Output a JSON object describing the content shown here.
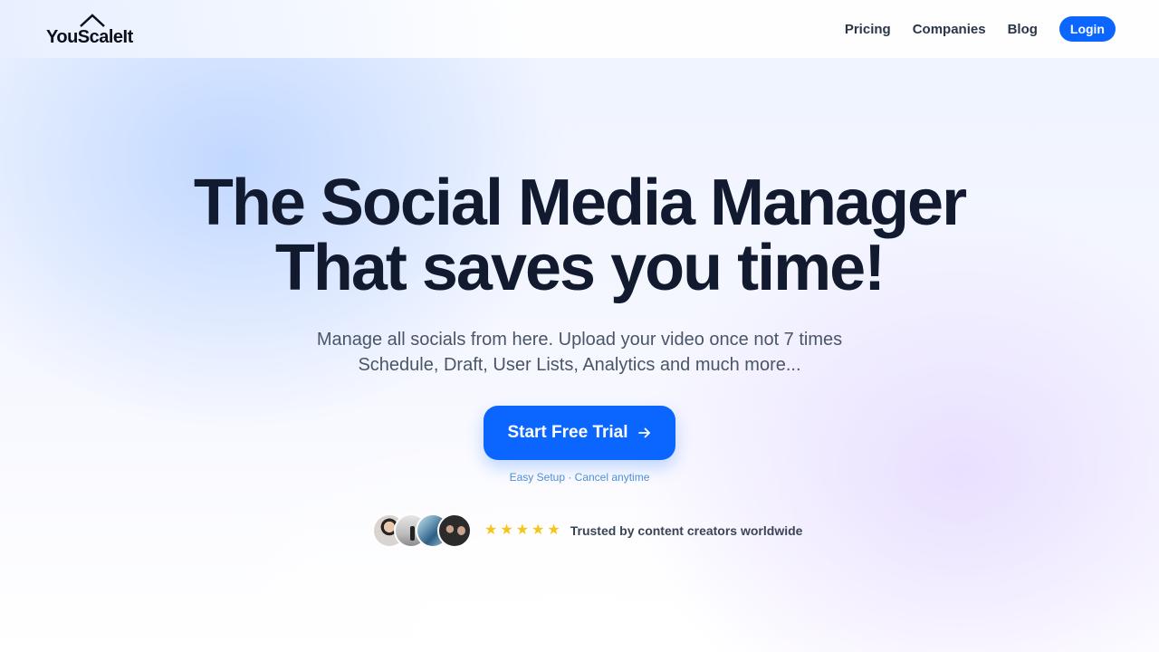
{
  "brand": {
    "name": "YouScaleIt"
  },
  "nav": {
    "links": [
      "Pricing",
      "Companies",
      "Blog"
    ],
    "login_label": "Login"
  },
  "hero": {
    "headline_line1": "The Social Media Manager",
    "headline_line2": "That saves you time!",
    "sub_line1": "Manage all socials from here. Upload your video once not 7 times",
    "sub_line2": "Schedule, Draft, User Lists, Analytics and much more...",
    "cta_label": "Start Free Trial",
    "note": "Easy Setup · Cancel anytime",
    "rating_stars": 5,
    "trusted_text": "Trusted by content creators worldwide"
  },
  "colors": {
    "accent": "#0a66ff",
    "headline": "#111a2e",
    "star": "#f5c518"
  }
}
